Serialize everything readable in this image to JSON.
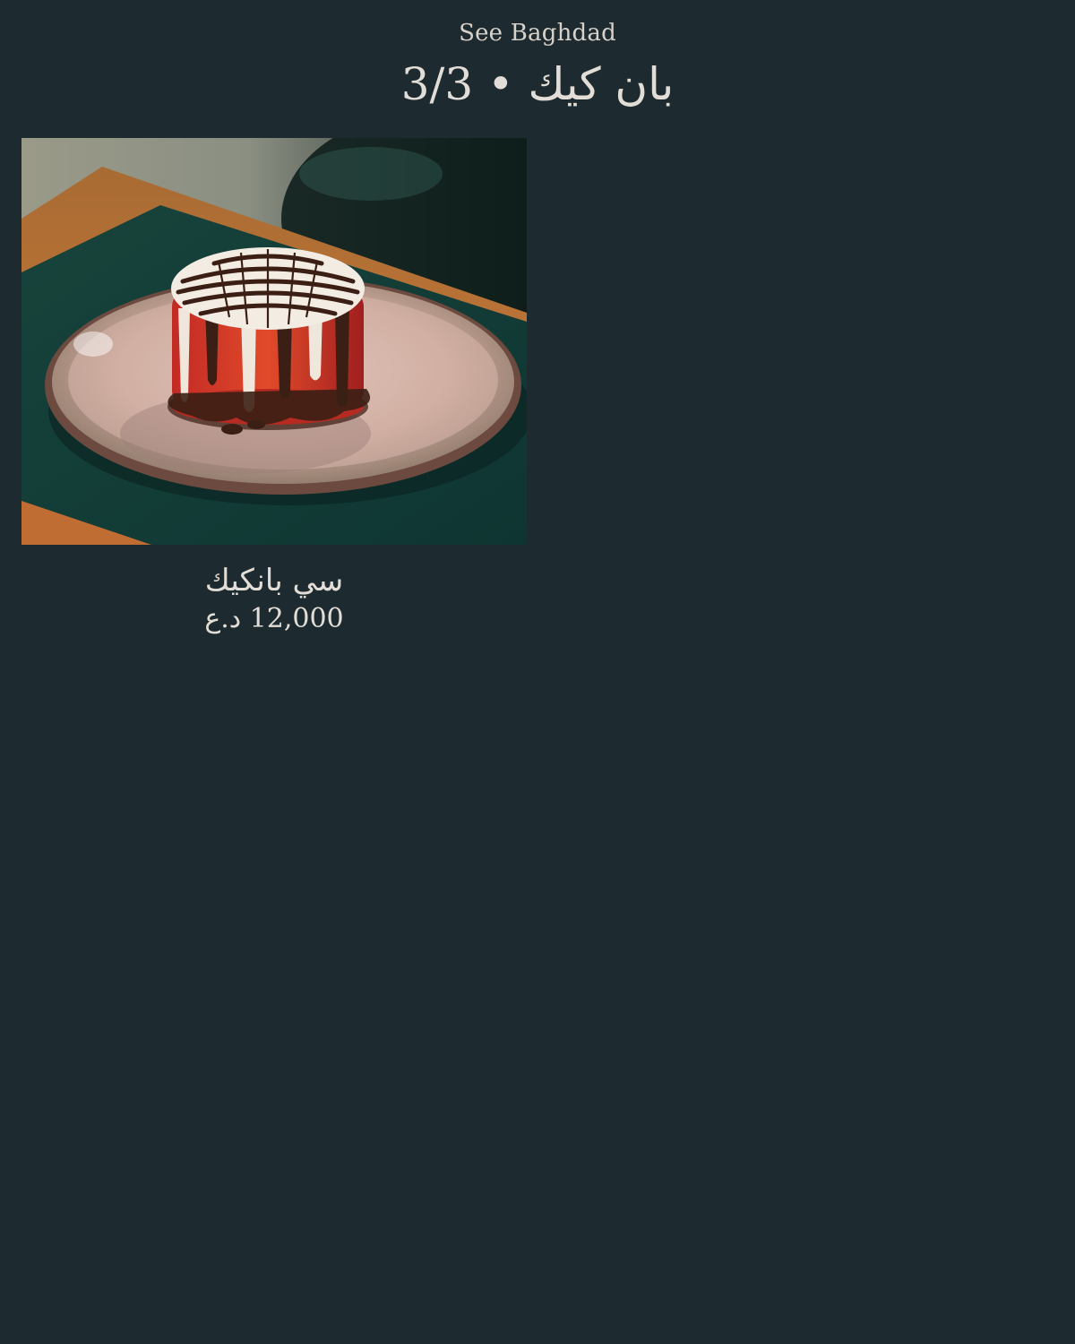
{
  "header": {
    "brand": "See Baghdad",
    "title": "بان كيك • 3/3"
  },
  "items": [
    {
      "name": "سي بانكيك",
      "price": "12,000 د.ع",
      "photo_alt": "dessert-photo"
    }
  ]
}
